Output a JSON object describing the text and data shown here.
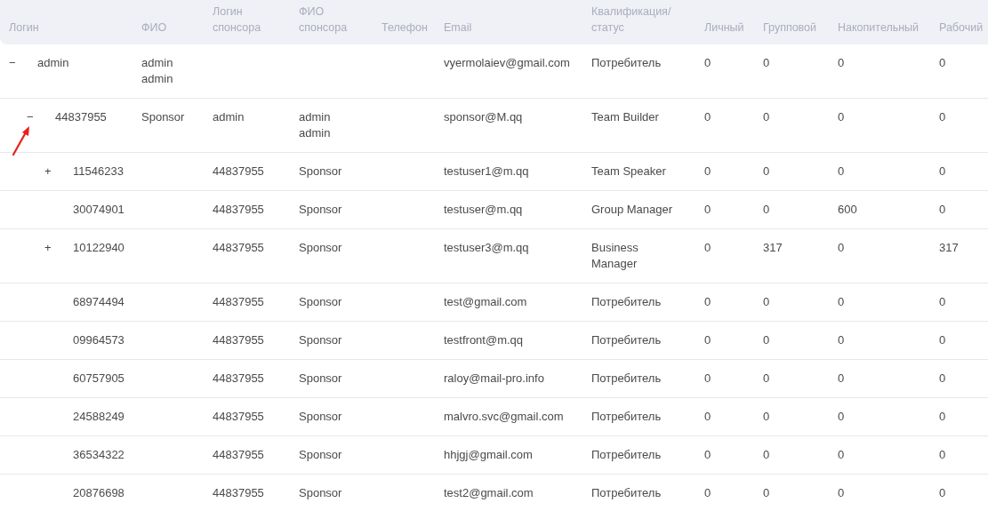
{
  "table": {
    "columns": [
      "Логин",
      "ФИО",
      "Логин\nспонсора",
      "ФИО\nспонсора",
      "Телефон",
      "Email",
      "Квалификация/\nстатус",
      "Личный",
      "Групповой",
      "Накопительный",
      "Рабочий"
    ],
    "rows": [
      {
        "toggle": "−",
        "login": "admin",
        "fio": "admin\nadmin",
        "email": "vyermolaiev@gmail.com",
        "status": "Потребитель",
        "personal": "0",
        "group": "0",
        "cumulative": "0",
        "working": "0",
        "children": [
          {
            "toggle": "−",
            "login": "44837955",
            "fio": "Sponsor",
            "sponsor_login": "admin",
            "sponsor_fio": "admin\nadmin",
            "email": "sponsor@M.qq",
            "status": "Team Builder",
            "personal": "0",
            "group": "0",
            "cumulative": "0",
            "working": "0",
            "children": [
              {
                "toggle": "+",
                "login": "11546233",
                "sponsor_login": "44837955",
                "sponsor_fio": "Sponsor",
                "email": "testuser1@m.qq",
                "status": "Team Speaker",
                "personal": "0",
                "group": "0",
                "cumulative": "0",
                "working": "0"
              },
              {
                "login": "30074901",
                "sponsor_login": "44837955",
                "sponsor_fio": "Sponsor",
                "email": "testuser@m.qq",
                "status": "Group Manager",
                "personal": "0",
                "group": "0",
                "cumulative": "600",
                "working": "0"
              },
              {
                "toggle": "+",
                "login": "10122940",
                "sponsor_login": "44837955",
                "sponsor_fio": "Sponsor",
                "email": "testuser3@m.qq",
                "status": "Business\nManager",
                "personal": "0",
                "group": "317",
                "cumulative": "0",
                "working": "317"
              },
              {
                "login": "68974494",
                "sponsor_login": "44837955",
                "sponsor_fio": "Sponsor",
                "email": "test@gmail.com",
                "status": "Потребитель",
                "personal": "0",
                "group": "0",
                "cumulative": "0",
                "working": "0"
              },
              {
                "login": "09964573",
                "sponsor_login": "44837955",
                "sponsor_fio": "Sponsor",
                "email": "testfront@m.qq",
                "status": "Потребитель",
                "personal": "0",
                "group": "0",
                "cumulative": "0",
                "working": "0"
              },
              {
                "login": "60757905",
                "sponsor_login": "44837955",
                "sponsor_fio": "Sponsor",
                "email": "raloy@mail-pro.info",
                "status": "Потребитель",
                "personal": "0",
                "group": "0",
                "cumulative": "0",
                "working": "0"
              },
              {
                "login": "24588249",
                "sponsor_login": "44837955",
                "sponsor_fio": "Sponsor",
                "email": "malvro.svc@gmail.com",
                "status": "Потребитель",
                "personal": "0",
                "group": "0",
                "cumulative": "0",
                "working": "0"
              },
              {
                "login": "36534322",
                "sponsor_login": "44837955",
                "sponsor_fio": "Sponsor",
                "email": "hhjgj@gmail.com",
                "status": "Потребитель",
                "personal": "0",
                "group": "0",
                "cumulative": "0",
                "working": "0"
              },
              {
                "login": "20876698",
                "sponsor_login": "44837955",
                "sponsor_fio": "Sponsor",
                "email": "test2@gmail.com",
                "status": "Потребитель",
                "personal": "0",
                "group": "0",
                "cumulative": "0",
                "working": "0"
              }
            ]
          }
        ]
      }
    ]
  }
}
